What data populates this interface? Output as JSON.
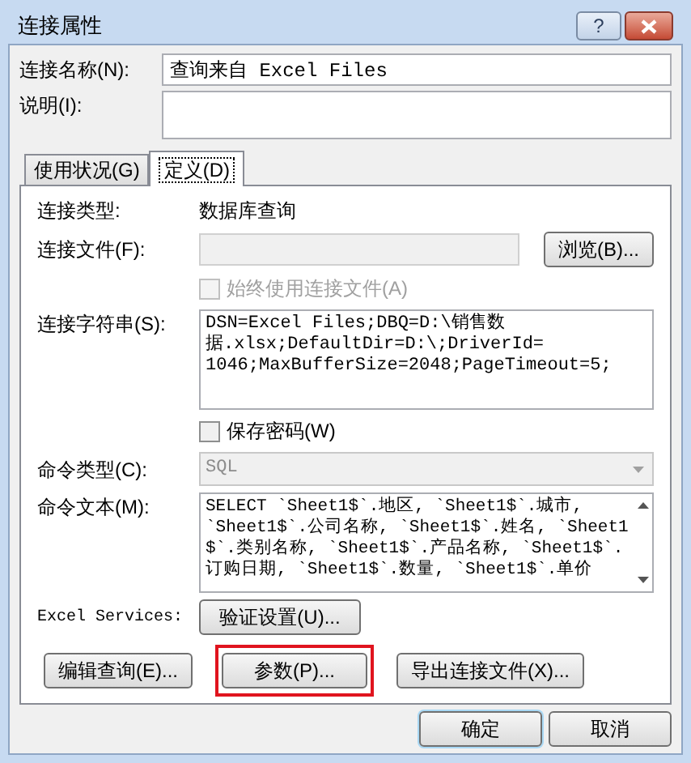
{
  "window": {
    "title": "连接属性",
    "help": "?"
  },
  "connection_name": {
    "label": "连接名称(N):",
    "value": "查询来自 Excel Files"
  },
  "description": {
    "label": "说明(I):"
  },
  "tabs": [
    {
      "label": "使用状况(G)",
      "selected": false
    },
    {
      "label": "定义(D)",
      "selected": true
    }
  ],
  "definition": {
    "connection_type": {
      "label": "连接类型:",
      "value": "数据库查询"
    },
    "connection_file": {
      "label": "连接文件(F):",
      "disabled": true,
      "button": "浏览(B)..."
    },
    "always_use_file": {
      "label": "始终使用连接文件(A)",
      "checked": false,
      "disabled": true
    },
    "connection_string": {
      "label": "连接字符串(S):",
      "lines": [
        "DSN=Excel Files;DBQ=D:\\销售数",
        "据.xlsx;DefaultDir=D:\\;DriverId=",
        "1046;MaxBufferSize=2048;PageTimeout=5;"
      ]
    },
    "save_password": {
      "label": "保存密码(W)",
      "checked": false,
      "disabled": false
    },
    "command_type": {
      "label": "命令类型(C):",
      "value": "SQL",
      "disabled": true
    },
    "command_text": {
      "label": "命令文本(M):",
      "lines": [
        "SELECT `Sheet1$`.地区, `Sheet1$`.城市,",
        "`Sheet1$`.公司名称, `Sheet1$`.姓名, `Sheet1",
        "$`.类别名称, `Sheet1$`.产品名称, `Sheet1$`.",
        "订购日期, `Sheet1$`.数量, `Sheet1$`.单价"
      ]
    },
    "excel_services": {
      "label": "Excel Services:",
      "button": "验证设置(U)..."
    },
    "buttons": [
      {
        "label": "编辑查询(E)...",
        "highlighted": false
      },
      {
        "label": "参数(P)...",
        "highlighted": true
      },
      {
        "label": "导出连接文件(X)...",
        "highlighted": false
      }
    ]
  },
  "footer_buttons": [
    {
      "label": "确定"
    },
    {
      "label": "取消"
    }
  ]
}
